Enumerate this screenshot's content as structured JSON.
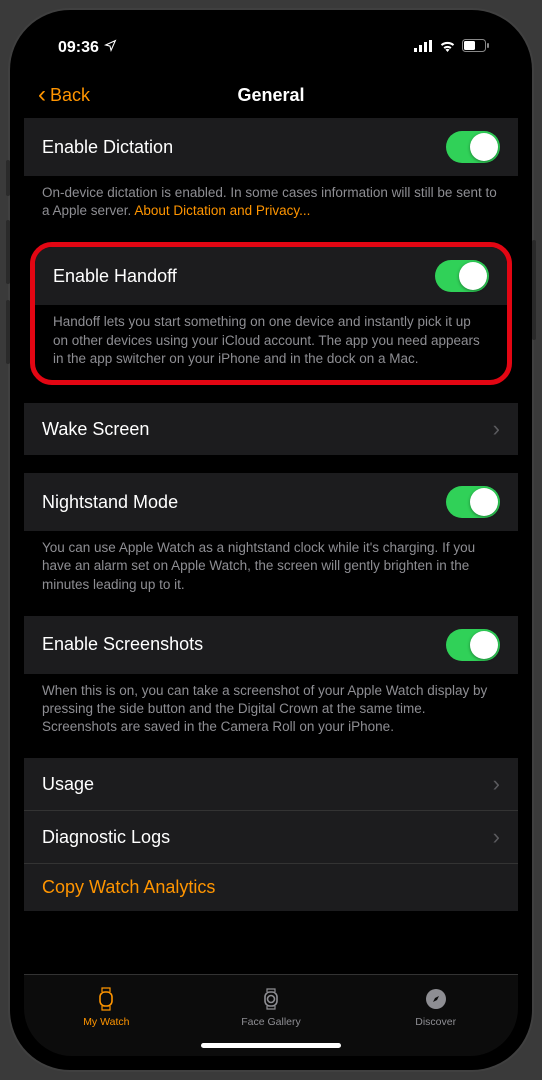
{
  "status": {
    "time": "09:36"
  },
  "nav": {
    "back": "Back",
    "title": "General"
  },
  "dictation": {
    "label": "Enable Dictation",
    "footer": "On-device dictation is enabled. In some cases information will still be sent to a Apple server. ",
    "link": "About Dictation and Privacy..."
  },
  "handoff": {
    "label": "Enable Handoff",
    "footer": "Handoff lets you start something on one device and instantly pick it up on other devices using your iCloud account. The app you need appears in the app switcher on your iPhone and in the dock on a Mac."
  },
  "wake": {
    "label": "Wake Screen"
  },
  "nightstand": {
    "label": "Nightstand Mode",
    "footer": "You can use Apple Watch as a nightstand clock while it's charging. If you have an alarm set on Apple Watch, the screen will gently brighten in the minutes leading up to it."
  },
  "screenshots": {
    "label": "Enable Screenshots",
    "footer": "When this is on, you can take a screenshot of your Apple Watch display by pressing the side button and the Digital Crown at the same time. Screenshots are saved in the Camera Roll on your iPhone."
  },
  "usage": {
    "label": "Usage"
  },
  "diag": {
    "label": "Diagnostic Logs"
  },
  "copy": {
    "label": "Copy Watch Analytics"
  },
  "tabs": {
    "watch": "My Watch",
    "gallery": "Face Gallery",
    "discover": "Discover"
  }
}
